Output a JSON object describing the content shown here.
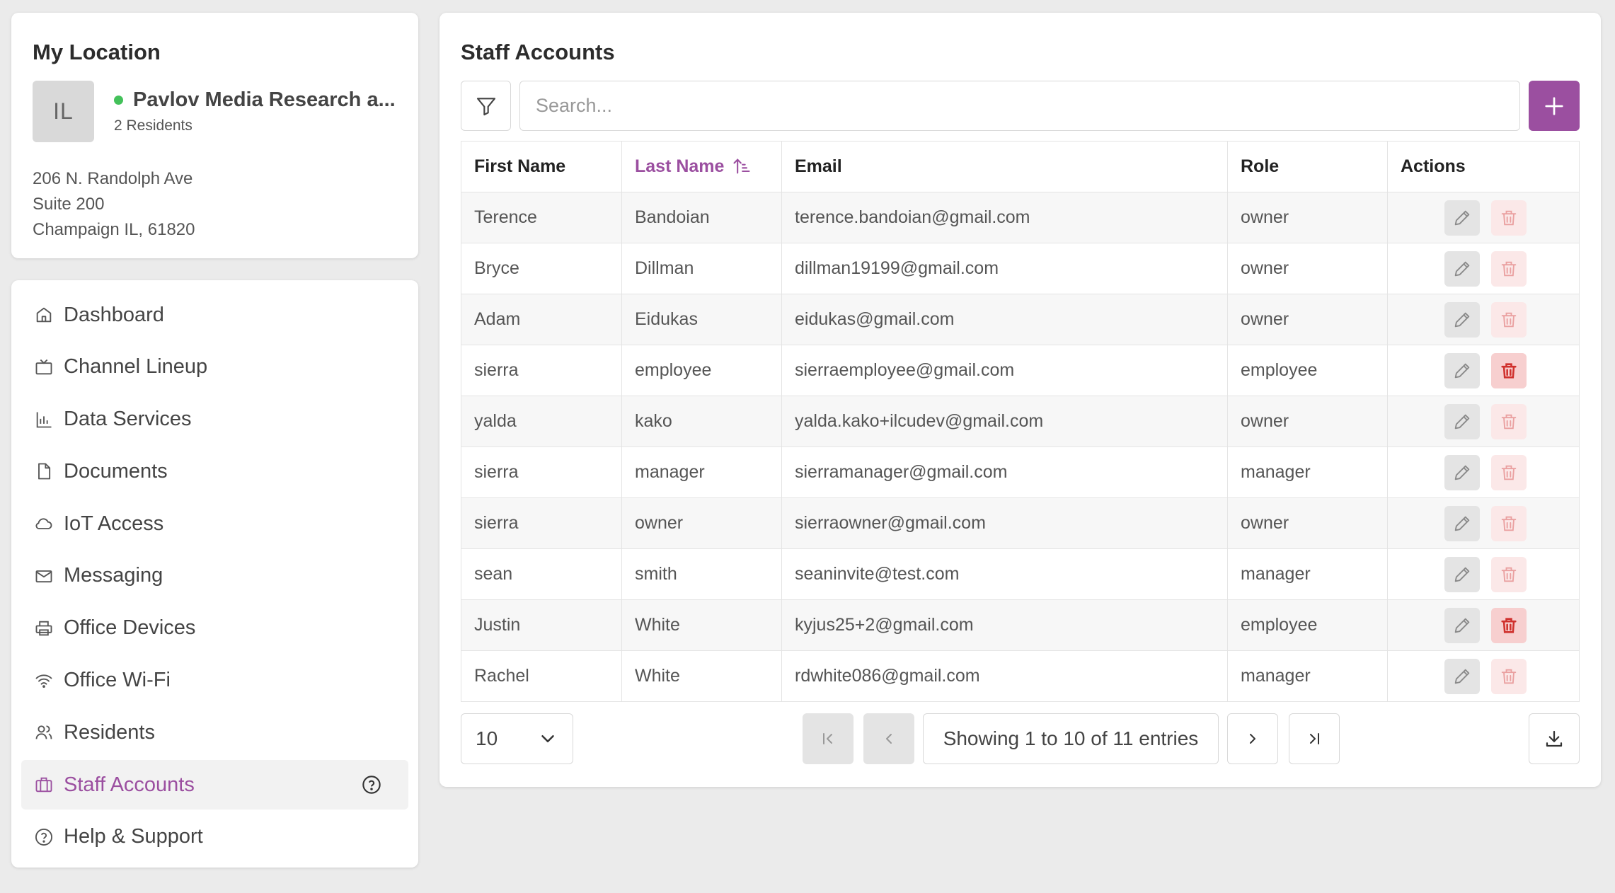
{
  "location": {
    "title": "My Location",
    "avatar_initials": "IL",
    "name": "Pavlov Media Research a...",
    "residents": "2 Residents",
    "address": [
      "206 N. Randolph Ave",
      "Suite 200",
      "Champaign IL, 61820"
    ],
    "status_color": "#43c15a"
  },
  "nav": {
    "items": [
      {
        "label": "Dashboard",
        "icon": "home-icon"
      },
      {
        "label": "Channel Lineup",
        "icon": "tv-icon"
      },
      {
        "label": "Data Services",
        "icon": "chart-icon"
      },
      {
        "label": "Documents",
        "icon": "document-icon"
      },
      {
        "label": "IoT Access",
        "icon": "cloud-icon"
      },
      {
        "label": "Messaging",
        "icon": "mail-icon"
      },
      {
        "label": "Office Devices",
        "icon": "printer-icon"
      },
      {
        "label": "Office Wi-Fi",
        "icon": "wifi-icon"
      },
      {
        "label": "Residents",
        "icon": "users-icon"
      },
      {
        "label": "Staff Accounts",
        "icon": "briefcase-icon",
        "active": true
      },
      {
        "label": "Help & Support",
        "icon": "help-circle-icon"
      }
    ]
  },
  "main": {
    "title": "Staff Accounts",
    "search_placeholder": "Search...",
    "columns": [
      "First Name",
      "Last Name",
      "Email",
      "Role",
      "Actions"
    ],
    "sorted_column": "Last Name",
    "rows": [
      {
        "first": "Terence",
        "last": "Bandoian",
        "email": "terence.bandoian@gmail.com",
        "role": "owner",
        "delete_active": false
      },
      {
        "first": "Bryce",
        "last": "Dillman",
        "email": "dillman19199@gmail.com",
        "role": "owner",
        "delete_active": false
      },
      {
        "first": "Adam",
        "last": "Eidukas",
        "email": "eidukas@gmail.com",
        "role": "owner",
        "delete_active": false
      },
      {
        "first": "sierra",
        "last": "employee",
        "email": "sierraemployee@gmail.com",
        "role": "employee",
        "delete_active": true
      },
      {
        "first": "yalda",
        "last": "kako",
        "email": "yalda.kako+ilcudev@gmail.com",
        "role": "owner",
        "delete_active": false
      },
      {
        "first": "sierra",
        "last": "manager",
        "email": "sierramanager@gmail.com",
        "role": "manager",
        "delete_active": false
      },
      {
        "first": "sierra",
        "last": "owner",
        "email": "sierraowner@gmail.com",
        "role": "owner",
        "delete_active": false
      },
      {
        "first": "sean",
        "last": "smith",
        "email": "seaninvite@test.com",
        "role": "manager",
        "delete_active": false
      },
      {
        "first": "Justin",
        "last": "White",
        "email": "kyjus25+2@gmail.com",
        "role": "employee",
        "delete_active": true
      },
      {
        "first": "Rachel",
        "last": "White",
        "email": "rdwhite086@gmail.com",
        "role": "manager",
        "delete_active": false
      }
    ],
    "page_size": "10",
    "page_info": "Showing 1 to 10 of 11 entries"
  },
  "colors": {
    "accent": "#9b4fa0",
    "danger": "#d0312d"
  }
}
